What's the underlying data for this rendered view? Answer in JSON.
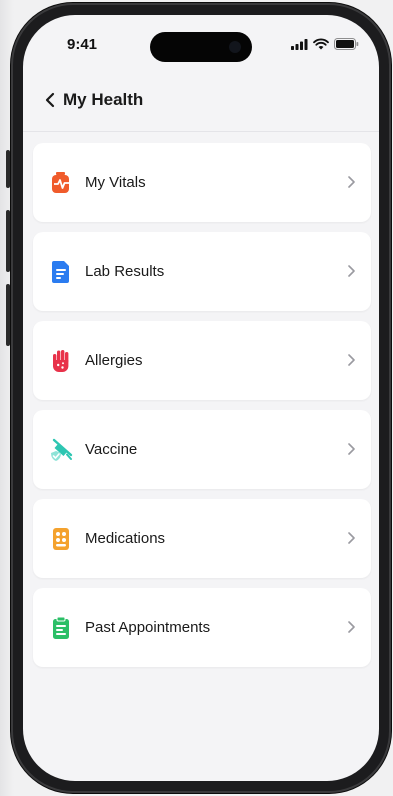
{
  "status_bar": {
    "time": "9:41"
  },
  "header": {
    "title": "My Health"
  },
  "menu": [
    {
      "label": "My Vitals",
      "icon": "vitals-icon",
      "color": "#f05b2b"
    },
    {
      "label": "Lab Results",
      "icon": "lab-report-icon",
      "color": "#2b7cf0"
    },
    {
      "label": "Allergies",
      "icon": "hand-icon",
      "color": "#e8324a"
    },
    {
      "label": "Vaccine",
      "icon": "syringe-icon",
      "color": "#2ec6b2"
    },
    {
      "label": "Medications",
      "icon": "pill-pack-icon",
      "color": "#f4a22e"
    },
    {
      "label": "Past Appointments",
      "icon": "clipboard-icon",
      "color": "#2bbf67"
    }
  ]
}
